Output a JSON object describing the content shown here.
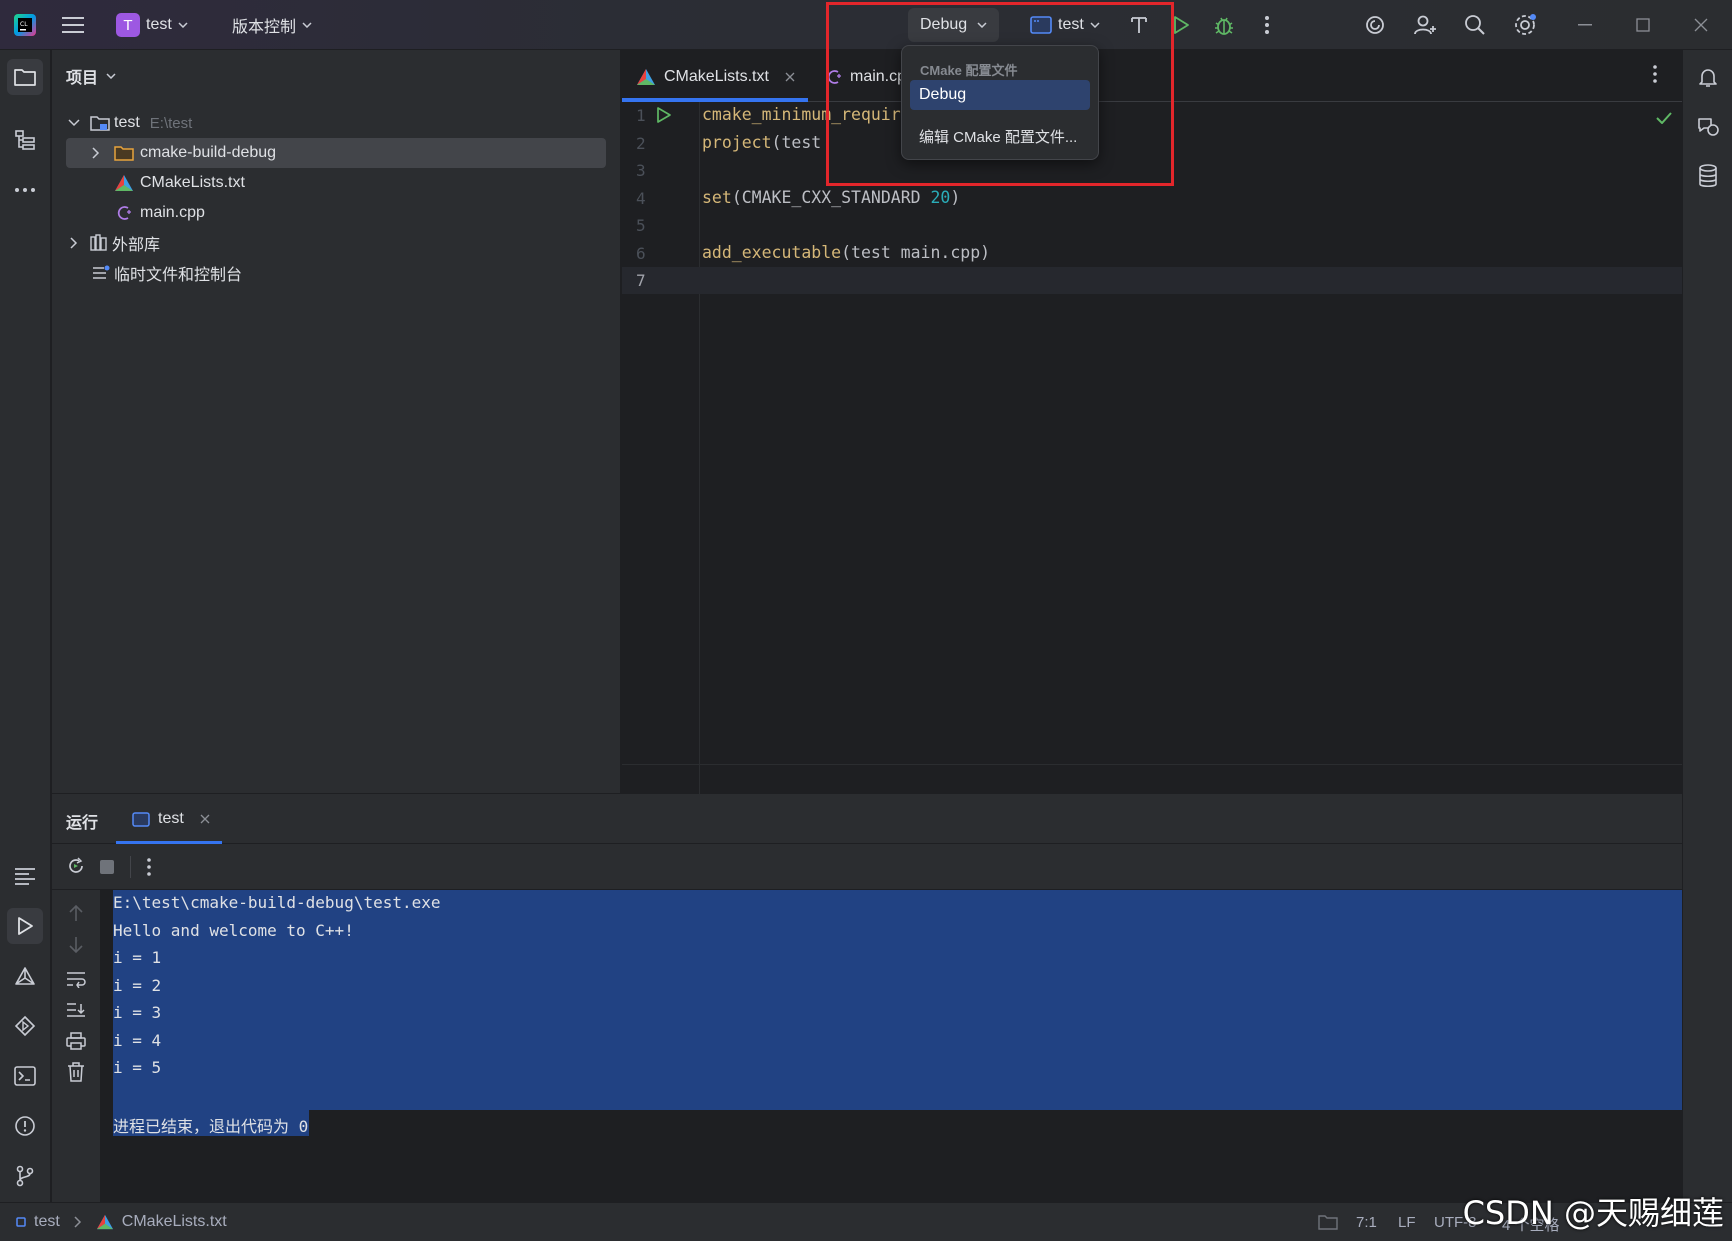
{
  "titlebar": {
    "project_initial": "T",
    "project_name": "test",
    "vcs_label": "版本控制",
    "config_label": "Debug",
    "run_target": "test"
  },
  "project_panel": {
    "title": "项目",
    "tree": [
      {
        "label": "test",
        "path": "E:\\test"
      },
      {
        "label": "cmake-build-debug"
      },
      {
        "label": "CMakeLists.txt"
      },
      {
        "label": "main.cpp"
      },
      {
        "label": "外部库"
      },
      {
        "label": "临时文件和控制台"
      }
    ]
  },
  "editor": {
    "tabs": [
      {
        "label": "CMakeLists.txt",
        "active": true
      },
      {
        "label": "main.cp",
        "active": false
      }
    ],
    "lines": [
      {
        "n": "1",
        "parts": [
          {
            "t": "cmake_minimum_requir",
            "c": "kw"
          }
        ]
      },
      {
        "n": "2",
        "parts": [
          {
            "t": "project",
            "c": "kw"
          },
          {
            "t": "(test",
            "c": ""
          }
        ]
      },
      {
        "n": "3",
        "parts": []
      },
      {
        "n": "4",
        "parts": [
          {
            "t": "set",
            "c": "kw"
          },
          {
            "t": "(CMAKE_CXX_STANDARD ",
            "c": ""
          },
          {
            "t": "20",
            "c": "num"
          },
          {
            "t": ")",
            "c": ""
          }
        ]
      },
      {
        "n": "5",
        "parts": []
      },
      {
        "n": "6",
        "parts": [
          {
            "t": "add_executable",
            "c": "kw"
          },
          {
            "t": "(test main.cpp)",
            "c": ""
          }
        ]
      },
      {
        "n": "7",
        "parts": []
      }
    ]
  },
  "popup": {
    "header": "CMake 配置文件",
    "items": [
      {
        "label": "Debug",
        "selected": true
      },
      {
        "label": "编辑 CMake 配置文件..."
      }
    ]
  },
  "run_panel": {
    "title": "运行",
    "tab_label": "test",
    "console_lines": [
      "E:\\test\\cmake-build-debug\\test.exe",
      "Hello and welcome to C++!",
      "i = 1",
      "i = 2",
      "i = 3",
      "i = 4",
      "i = 5",
      "",
      "进程已结束，退出代码为 0"
    ]
  },
  "statusbar": {
    "crumb_project": "test",
    "crumb_file": "CMakeLists.txt",
    "position": "7:1",
    "line_sep": "LF",
    "encoding": "UTF-8",
    "indent": "4 个空格"
  },
  "watermark": "CSDN @天赐细莲",
  "colors": {
    "accent": "#3574f0",
    "selection": "#214283",
    "highlight_box": "#e3262b",
    "keyword": "#d5b778",
    "number": "#2aacb8",
    "run_green": "#5fb865"
  }
}
